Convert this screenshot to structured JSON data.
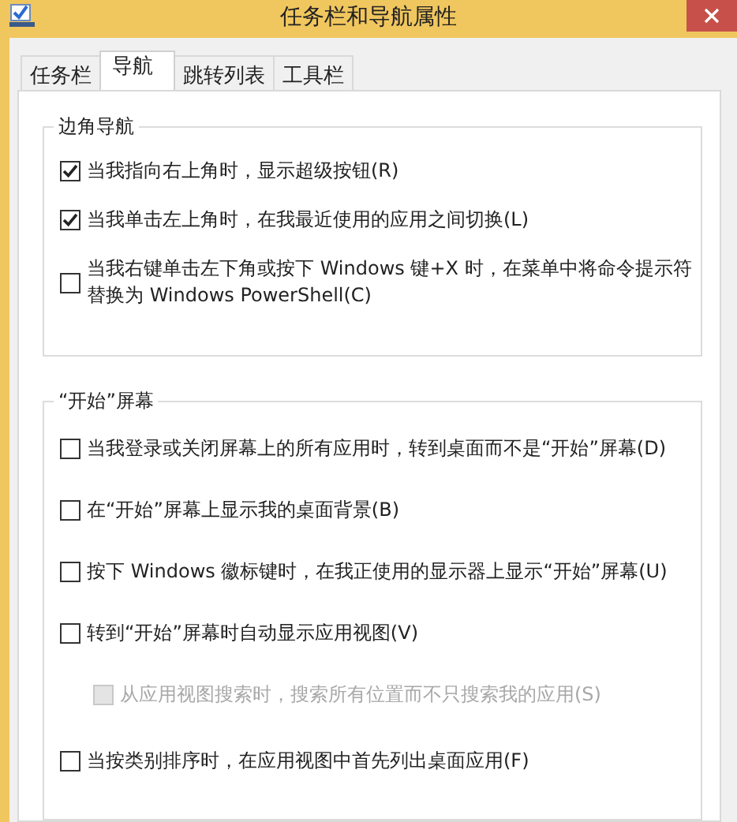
{
  "window": {
    "title": "任务栏和导航属性"
  },
  "tabs": [
    {
      "label": "任务栏",
      "selected": false
    },
    {
      "label": "导航",
      "selected": true
    },
    {
      "label": "跳转列表",
      "selected": false
    },
    {
      "label": "工具栏",
      "selected": false
    }
  ],
  "groups": [
    {
      "title": "边角导航",
      "options": [
        {
          "label": "当我指向右上角时，显示超级按钮(R)",
          "checked": true,
          "disabled": false
        },
        {
          "label": "当我单击左上角时，在我最近使用的应用之间切换(L)",
          "checked": true,
          "disabled": false
        },
        {
          "label": "当我右键单击左下角或按下 Windows 键+X 时，在菜单中将命令提示符替换为 Windows PowerShell(C)",
          "checked": false,
          "disabled": false
        }
      ]
    },
    {
      "title": "“开始”屏幕",
      "options": [
        {
          "label": "当我登录或关闭屏幕上的所有应用时，转到桌面而不是“开始”屏幕(D)",
          "checked": false,
          "disabled": false
        },
        {
          "label": "在“开始”屏幕上显示我的桌面背景(B)",
          "checked": false,
          "disabled": false
        },
        {
          "label": "按下 Windows 徽标键时，在我正使用的显示器上显示“开始”屏幕(U)",
          "checked": false,
          "disabled": false
        },
        {
          "label": "转到“开始”屏幕时自动显示应用视图(V)",
          "checked": false,
          "disabled": false,
          "children": [
            {
              "label": "从应用视图搜索时，搜索所有位置而不只搜索我的应用(S)",
              "checked": false,
              "disabled": true
            }
          ]
        },
        {
          "label": "当按类别排序时，在应用视图中首先列出桌面应用(F)",
          "checked": false,
          "disabled": false
        }
      ]
    }
  ]
}
